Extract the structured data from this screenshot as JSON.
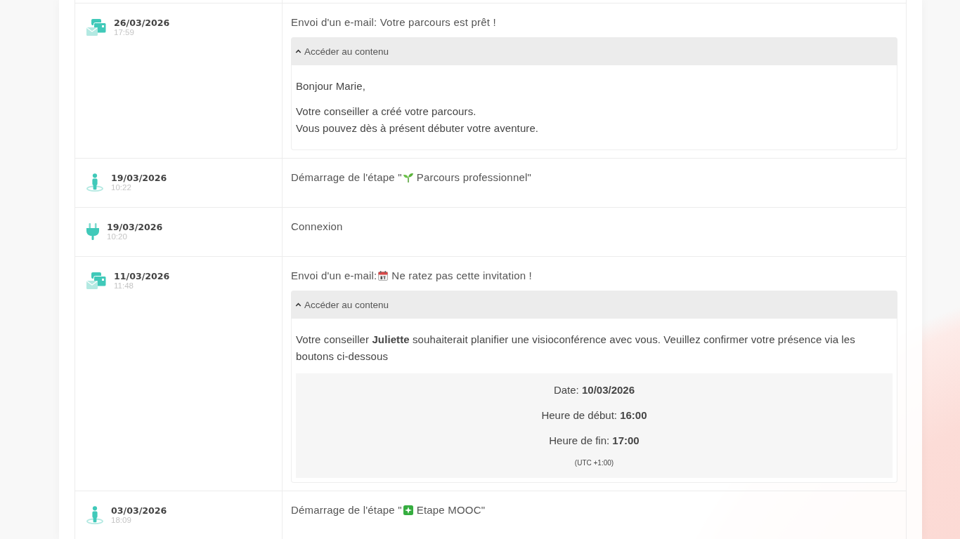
{
  "rows": [
    {
      "kind": "email",
      "date": "26/03/2026",
      "time": "17:59",
      "title": [
        {
          "kind": "text",
          "text": "Envoi d'un e-mail: Votre parcours est prêt !"
        }
      ],
      "content": {
        "toggle": "Accéder au contenu",
        "expanded": true,
        "paragraphs": [
          [
            "Bonjour Marie,"
          ],
          [
            "Votre conseiller a créé votre parcours.",
            "Vous pouvez dès à présent débuter votre aventure."
          ]
        ]
      }
    },
    {
      "kind": "step",
      "date": "19/03/2026",
      "time": "10:22",
      "title": [
        {
          "kind": "text",
          "text": "Démarrage de l'étape \""
        },
        {
          "kind": "plant"
        },
        {
          "kind": "text",
          "text": "Parcours professionnel\""
        }
      ]
    },
    {
      "kind": "login",
      "date": "19/03/2026",
      "time": "10:20",
      "title": [
        {
          "kind": "text",
          "text": "Connexion"
        }
      ]
    },
    {
      "kind": "email",
      "date": "11/03/2026",
      "time": "11:48",
      "title": [
        {
          "kind": "text",
          "text": "Envoi d'un e-mail:"
        },
        {
          "kind": "calendar"
        },
        {
          "kind": "text",
          "text": "Ne ratez pas cette invitation !"
        }
      ],
      "content": {
        "toggle": "Accéder au contenu",
        "expanded": true,
        "paragraphs": [
          [
            "Votre conseiller **Juliette** souhaiterait planifier une visioconférence avec vous. Veuillez confirmer votre présence via les boutons ci-dessous"
          ]
        ],
        "details": {
          "lines": [
            "Date: **10/03/2026**",
            "Heure de début: **16:00**",
            "Heure de fin: **17:00**"
          ],
          "note": "(UTC +1:00)"
        }
      }
    },
    {
      "kind": "step",
      "date": "03/03/2026",
      "time": "18:09",
      "title": [
        {
          "kind": "text",
          "text": "Démarrage de l'étape \""
        },
        {
          "kind": "sparkle"
        },
        {
          "kind": "text",
          "text": "Etape MOOC\""
        }
      ]
    }
  ]
}
